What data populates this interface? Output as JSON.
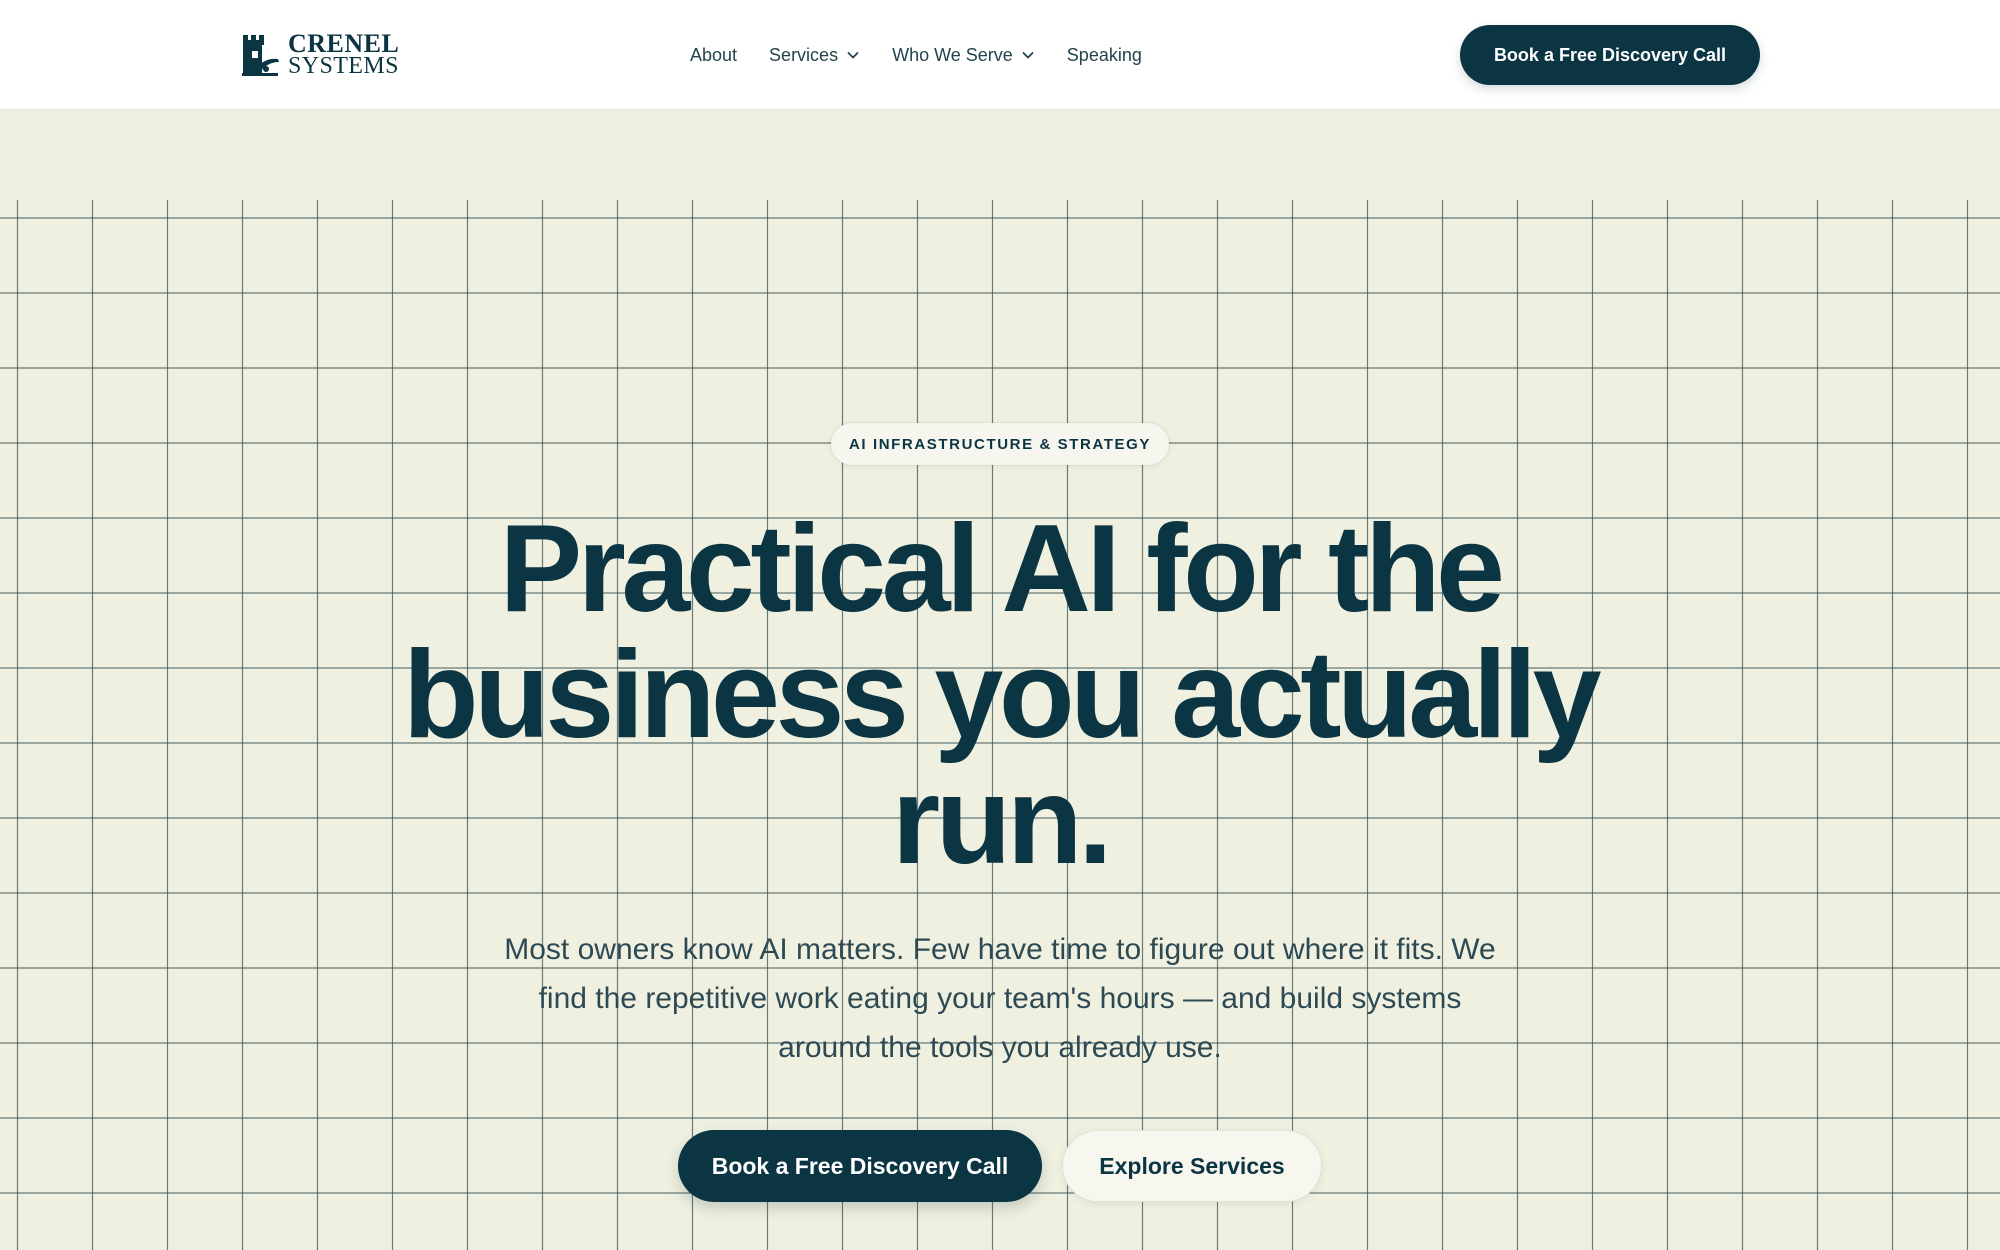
{
  "brand": {
    "line1": "CRENEL",
    "line2": "SYSTEMS",
    "icon": "castle-tower-icon"
  },
  "nav": {
    "items": [
      {
        "label": "About",
        "has_dropdown": false
      },
      {
        "label": "Services",
        "has_dropdown": true
      },
      {
        "label": "Who We Serve",
        "has_dropdown": true
      },
      {
        "label": "Speaking",
        "has_dropdown": false
      }
    ]
  },
  "header": {
    "cta_label": "Book a Free Discovery Call"
  },
  "hero": {
    "eyebrow": "AI INFRASTRUCTURE & STRATEGY",
    "headline": "Practical AI for the business you actually run.",
    "subtext": "Most owners know AI matters. Few have time to figure out where it fits. We find the repetitive work eating your team's hours — and build systems around the tools you already use.",
    "primary_cta": "Book a Free Discovery Call",
    "secondary_cta": "Explore Services"
  },
  "colors": {
    "brand_dark": "#0b3542",
    "hero_background": "#f0f0e0",
    "header_background": "#ffffff",
    "grid_line": "#3a5458"
  }
}
